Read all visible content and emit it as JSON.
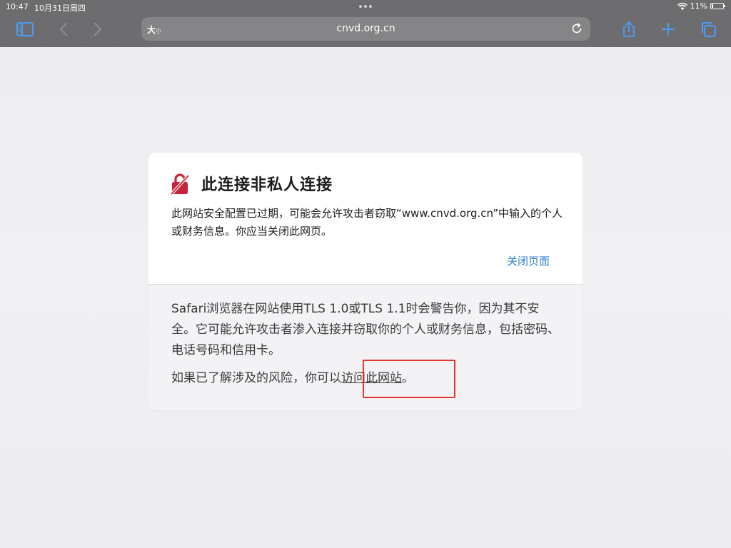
{
  "status": {
    "time": "10:47",
    "date": "10月31日周四",
    "battery": "11%"
  },
  "url": {
    "text_size_label": "大",
    "text_size_small": "小",
    "address": "cnvd.org.cn"
  },
  "warning": {
    "title": "此连接非私人连接",
    "description": "此网站安全配置已过期，可能会允许攻击者窃取“www.cnvd.org.cn”中输入的个人或财务信息。你应当关闭此网页。",
    "close_label": "关闭页面",
    "explanation": "Safari浏览器在网站使用TLS 1.0或TLS 1.1时会警告你，因为其不安全。它可能允许攻击者渗入连接并窃取你的个人或财务信息，包括密码、电话号码和信用卡。",
    "proceed_prefix": "如果已了解涉及的风险，你可以",
    "visit_label": "访问此网站",
    "proceed_suffix": "。"
  },
  "colors": {
    "accent_link": "#2f7fd0",
    "lock_red": "#c8253d",
    "highlight": "#e8332e",
    "chrome": "#6d6d70"
  },
  "icons": [
    "wifi-icon",
    "battery-icon",
    "sidebar-icon",
    "back-icon",
    "forward-icon",
    "reload-icon",
    "share-icon",
    "plus-icon",
    "tabs-icon",
    "lock-warning-icon"
  ]
}
